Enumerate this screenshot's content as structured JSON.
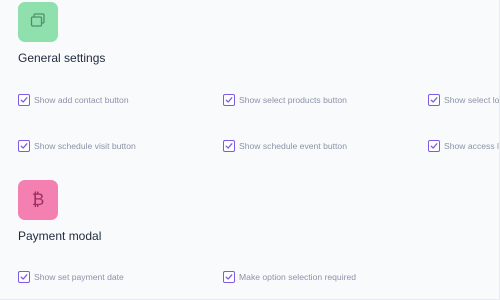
{
  "colors": {
    "background": "#f9fafc",
    "general_tile": "#8fe0ac",
    "payment_tile": "#f47fb1",
    "checkbox_accent": "#7d5be6",
    "title_text": "#1f2a3d",
    "option_text": "#8a93a6"
  },
  "general": {
    "icon": "windows-stack-icon",
    "title": "General settings",
    "options": [
      {
        "label": "Show add contact button",
        "checked": true
      },
      {
        "label": "Show select products button",
        "checked": true
      },
      {
        "label": "Show select lo",
        "checked": true
      },
      {
        "label": "Show schedule visit button",
        "checked": true
      },
      {
        "label": "Show schedule event button",
        "checked": true
      },
      {
        "label": "Show access l",
        "checked": true
      }
    ]
  },
  "payment": {
    "icon": "bitcoin-icon",
    "glyph": "₿",
    "title": "Payment modal",
    "options": [
      {
        "label": "Show set payment date",
        "checked": true
      },
      {
        "label": "Make option selection required",
        "checked": true
      }
    ]
  }
}
